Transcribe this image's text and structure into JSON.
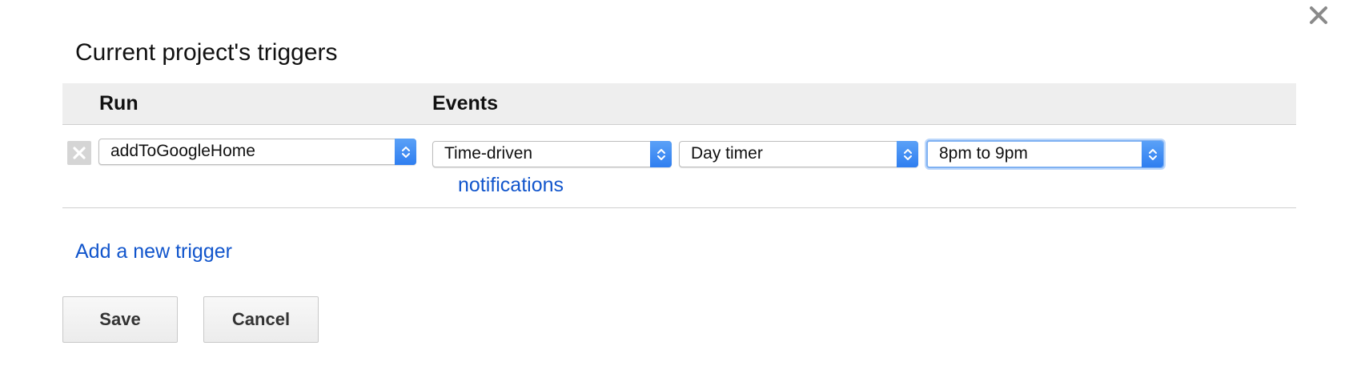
{
  "dialog": {
    "title": "Current project's triggers",
    "close_icon": "close-icon"
  },
  "table": {
    "headers": {
      "run": "Run",
      "events": "Events"
    },
    "rows": [
      {
        "delete_icon": "close-icon",
        "run_function": "addToGoogleHome",
        "event_source": "Time-driven",
        "event_type": "Day timer",
        "time_of_day": "8pm to 9pm",
        "notifications_label": "notifications"
      }
    ]
  },
  "actions": {
    "add_trigger_label": "Add a new trigger",
    "save_label": "Save",
    "cancel_label": "Cancel"
  },
  "colors": {
    "link": "#1155cc",
    "header_bg": "#eeeeee",
    "select_arrow": "#2f7ef0"
  }
}
